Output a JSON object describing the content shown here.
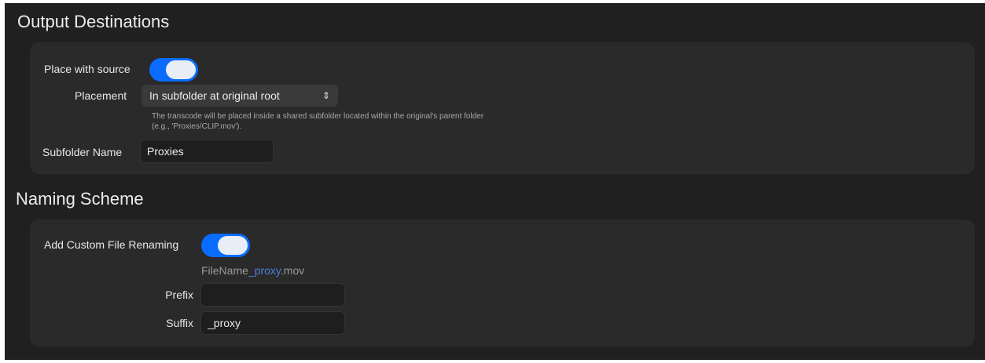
{
  "output_destinations": {
    "title": "Output Destinations",
    "place_with_source_label": "Place with source",
    "place_with_source_on": true,
    "placement_label": "Placement",
    "placement_value": "In subfolder at original root",
    "placement_help_line1": "The transcode will be placed inside a shared subfolder located within the original's parent folder",
    "placement_help_line2": "(e.g., 'Proxies/CLIP.mov').",
    "subfolder_name_label": "Subfolder Name",
    "subfolder_name_value": "Proxies"
  },
  "naming_scheme": {
    "title": "Naming Scheme",
    "custom_renaming_label": "Add Custom File Renaming",
    "custom_renaming_on": true,
    "preview_base": "FileName",
    "preview_suffix": "_proxy",
    "preview_ext": ".mov",
    "prefix_label": "Prefix",
    "prefix_value": "",
    "suffix_label": "Suffix",
    "suffix_value": "_proxy"
  },
  "colors": {
    "accent": "#0a6cff",
    "background": "#202020",
    "group_background": "#2a2a2a"
  },
  "icons": {
    "select_chevron": "up-down-chevron-icon"
  }
}
